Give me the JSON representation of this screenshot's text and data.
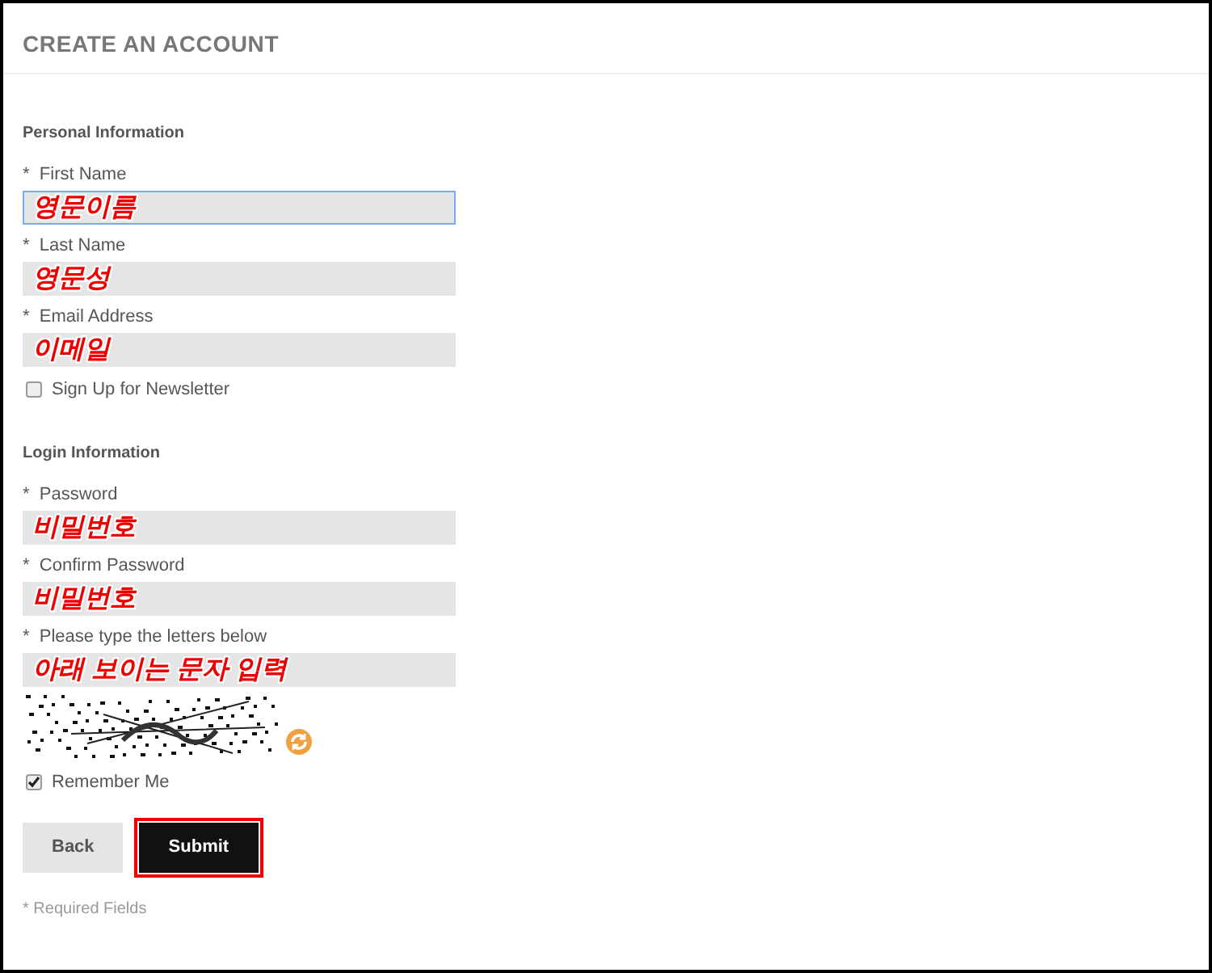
{
  "title": "CREATE AN ACCOUNT",
  "sections": [
    {
      "heading": "Personal Information",
      "items": [
        {
          "kind": "field",
          "label": "First Name",
          "required_mark": "*",
          "annotation": "영문이름",
          "focused": true
        },
        {
          "kind": "field",
          "label": "Last Name",
          "required_mark": "*",
          "annotation": "영문성",
          "focused": false
        },
        {
          "kind": "field",
          "label": "Email Address",
          "required_mark": "*",
          "annotation": "이메일",
          "focused": false
        },
        {
          "kind": "checkbox",
          "label": "Sign Up for Newsletter",
          "checked": false
        }
      ]
    },
    {
      "heading": "Login Information",
      "items": [
        {
          "kind": "field",
          "label": "Password",
          "required_mark": "*",
          "annotation": "비밀번호",
          "focused": false
        },
        {
          "kind": "field",
          "label": "Confirm Password",
          "required_mark": "*",
          "annotation": "비밀번호",
          "focused": false
        },
        {
          "kind": "field",
          "label": "Please type the letters below",
          "required_mark": "*",
          "annotation": "아래 보이는 문자 입력",
          "focused": false
        },
        {
          "kind": "captcha"
        },
        {
          "kind": "checkbox",
          "label": "Remember Me",
          "checked": true
        }
      ]
    }
  ],
  "buttons": [
    {
      "label": "Back",
      "kind": "secondary",
      "highlighted": false
    },
    {
      "label": "Submit",
      "kind": "primary",
      "highlighted": true
    }
  ],
  "footnote": "* Required Fields"
}
